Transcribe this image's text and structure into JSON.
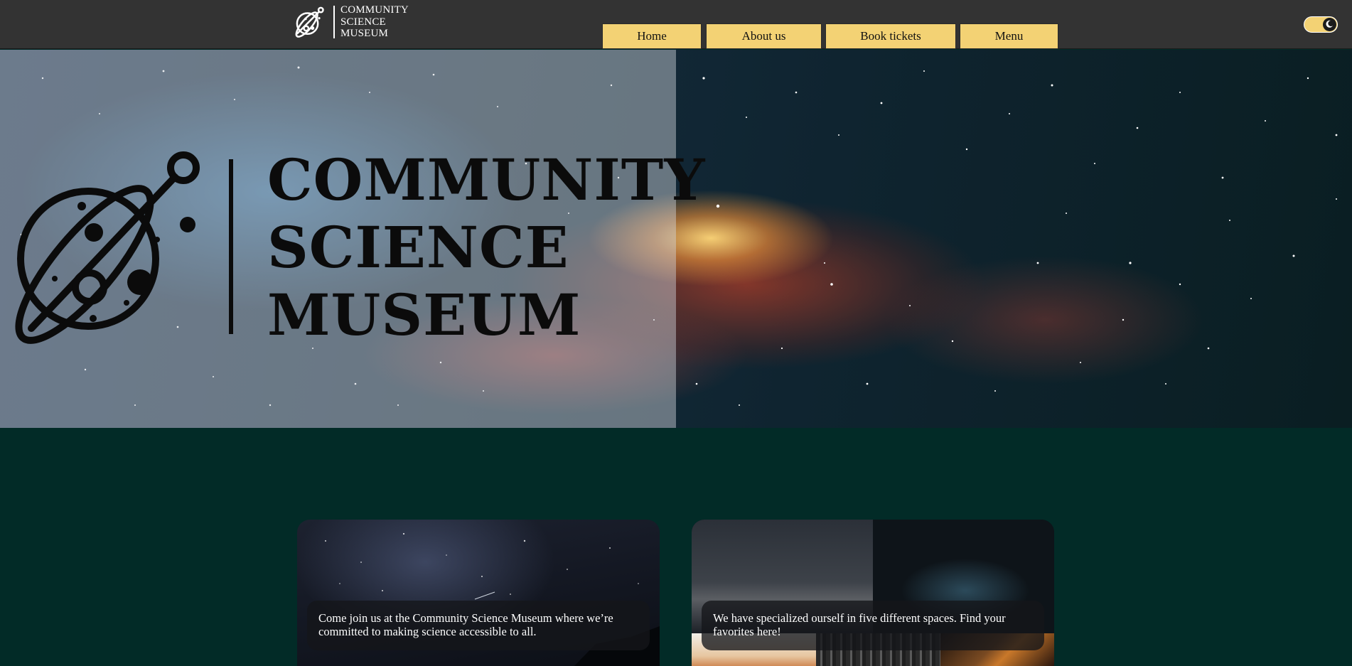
{
  "header": {
    "logo": {
      "icon": "planet-satellite-logo-icon",
      "text_lines": [
        "COMMUNITY",
        "SCIENCE",
        "MUSEUM"
      ]
    },
    "nav": {
      "items": [
        {
          "label": "Home"
        },
        {
          "label": "About us"
        },
        {
          "label": "Book tickets"
        },
        {
          "label": "Menu"
        }
      ],
      "button_color": "#f3d274"
    },
    "theme_toggle": {
      "icon": "moon-icon",
      "state": "dark"
    }
  },
  "hero": {
    "title_lines": [
      "COMMUNITY",
      "SCIENCE",
      "MUSEUM"
    ],
    "logo_icon": "planet-satellite-logo-icon"
  },
  "cards": [
    {
      "caption": "Come join us at the Community Science Museum where we’re committed to making science accessible to all."
    },
    {
      "caption": "We have specialized ourself in five different spaces. Find your favorites here!"
    }
  ],
  "colors": {
    "topbar": "#333333",
    "page_background": "#022b27",
    "accent": "#f3d274"
  }
}
